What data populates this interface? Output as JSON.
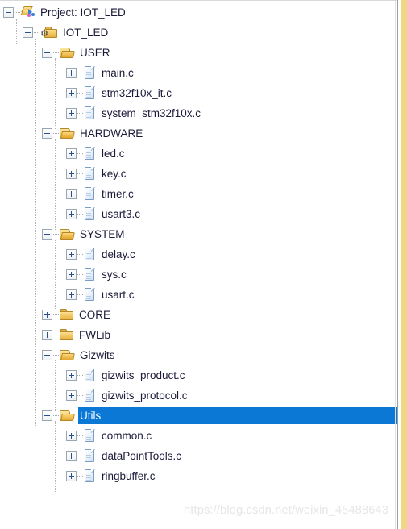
{
  "panel": {
    "name": "project-explorer-tree",
    "selection_color": "#0a78d4",
    "background_color": "#ffffff",
    "accent_folder_color": "#e8b13d"
  },
  "watermark": {
    "text": "https://blog.csdn.net/weixin_45488643"
  },
  "tree": {
    "nodes": [
      {
        "label": "Project: IOT_LED",
        "depth": 0,
        "icon": "project-icon",
        "toggle": "minus",
        "selected": false
      },
      {
        "label": "IOT_LED",
        "depth": 1,
        "icon": "folder-gear-icon",
        "toggle": "minus",
        "selected": false
      },
      {
        "label": "USER",
        "depth": 2,
        "icon": "folder-open-icon",
        "toggle": "minus",
        "selected": false
      },
      {
        "label": "main.c",
        "depth": 3,
        "icon": "source-file-icon",
        "toggle": "plus",
        "selected": false
      },
      {
        "label": "stm32f10x_it.c",
        "depth": 3,
        "icon": "source-file-icon",
        "toggle": "plus",
        "selected": false
      },
      {
        "label": "system_stm32f10x.c",
        "depth": 3,
        "icon": "source-file-icon",
        "toggle": "plus",
        "selected": false
      },
      {
        "label": "HARDWARE",
        "depth": 2,
        "icon": "folder-open-icon",
        "toggle": "minus",
        "selected": false
      },
      {
        "label": "led.c",
        "depth": 3,
        "icon": "source-file-icon",
        "toggle": "plus",
        "selected": false
      },
      {
        "label": "key.c",
        "depth": 3,
        "icon": "source-file-icon",
        "toggle": "plus",
        "selected": false
      },
      {
        "label": "timer.c",
        "depth": 3,
        "icon": "source-file-icon",
        "toggle": "plus",
        "selected": false
      },
      {
        "label": "usart3.c",
        "depth": 3,
        "icon": "source-file-icon",
        "toggle": "plus",
        "selected": false
      },
      {
        "label": "SYSTEM",
        "depth": 2,
        "icon": "folder-open-icon",
        "toggle": "minus",
        "selected": false
      },
      {
        "label": "delay.c",
        "depth": 3,
        "icon": "source-file-icon",
        "toggle": "plus",
        "selected": false
      },
      {
        "label": "sys.c",
        "depth": 3,
        "icon": "source-file-icon",
        "toggle": "plus",
        "selected": false
      },
      {
        "label": "usart.c",
        "depth": 3,
        "icon": "source-file-icon",
        "toggle": "plus",
        "selected": false
      },
      {
        "label": "CORE",
        "depth": 2,
        "icon": "folder-icon",
        "toggle": "plus",
        "selected": false
      },
      {
        "label": "FWLib",
        "depth": 2,
        "icon": "folder-icon",
        "toggle": "plus",
        "selected": false
      },
      {
        "label": "Gizwits",
        "depth": 2,
        "icon": "folder-open-icon",
        "toggle": "minus",
        "selected": false
      },
      {
        "label": "gizwits_product.c",
        "depth": 3,
        "icon": "source-file-icon",
        "toggle": "plus",
        "selected": false
      },
      {
        "label": "gizwits_protocol.c",
        "depth": 3,
        "icon": "source-file-icon",
        "toggle": "plus",
        "selected": false
      },
      {
        "label": "Utils",
        "depth": 2,
        "icon": "folder-open-icon",
        "toggle": "minus",
        "selected": true
      },
      {
        "label": "common.c",
        "depth": 3,
        "icon": "source-file-icon",
        "toggle": "plus",
        "selected": false
      },
      {
        "label": "dataPointTools.c",
        "depth": 3,
        "icon": "source-file-icon",
        "toggle": "plus",
        "selected": false
      },
      {
        "label": "ringbuffer.c",
        "depth": 3,
        "icon": "source-file-icon",
        "toggle": "plus",
        "selected": false
      }
    ]
  }
}
